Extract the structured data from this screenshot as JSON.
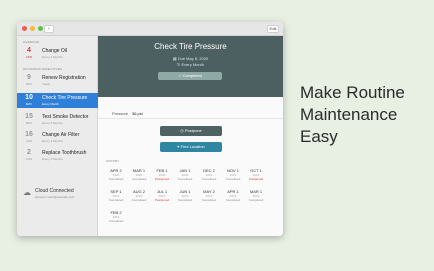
{
  "titlebar": {
    "back": "‹",
    "edit": "Edit"
  },
  "sidebar": {
    "overdue_header": "OVERDUE",
    "upcoming_header": "UPCOMING DIRECTIVES",
    "overdue": [
      {
        "num": "4",
        "mon": "APR",
        "name": "Change Oil",
        "sub": "Every 3 Months"
      }
    ],
    "upcoming": [
      {
        "num": "9",
        "mon": "MAY",
        "name": "Renew Registration",
        "sub": "Yearly"
      },
      {
        "num": "10",
        "mon": "MAY",
        "name": "Check Tire Pressure",
        "sub": "Every Month"
      },
      {
        "num": "15",
        "mon": "MAY",
        "name": "Test Smoke Detector",
        "sub": "Every 6 Months"
      },
      {
        "num": "16",
        "mon": "JUN",
        "name": "Change Air Filter",
        "sub": "Every 3 Months"
      },
      {
        "num": "2",
        "mon": "AUG",
        "name": "Replace Toothbrush",
        "sub": "Every 3 Months"
      }
    ],
    "cloud": {
      "title": "Cloud Connected",
      "sub": "Account: user@example.com"
    }
  },
  "detail": {
    "title": "Check Tire Pressure",
    "due": "Due May 8, 2020",
    "every": "Every Month",
    "completed": "Completed",
    "pressure_label": "Pressure",
    "pressure_value": "36 psi",
    "postpone": "Postpone",
    "find_location": "Find Location",
    "history_header": "HISTORY",
    "history": [
      {
        "d": "APR 2",
        "y": "2020",
        "s": "Completed",
        "late": false
      },
      {
        "d": "MAR 1",
        "y": "2020",
        "s": "Completed",
        "late": false
      },
      {
        "d": "FEB 1",
        "y": "2020",
        "s": "Postponed",
        "late": true
      },
      {
        "d": "JAN 1",
        "y": "2020",
        "s": "Completed",
        "late": false
      },
      {
        "d": "DEC 2",
        "y": "2019",
        "s": "Completed",
        "late": false
      },
      {
        "d": "NOV 1",
        "y": "2019",
        "s": "Completed",
        "late": false
      },
      {
        "d": "OCT 1",
        "y": "2019",
        "s": "Postponed",
        "late": true
      },
      {
        "d": "SEP 1",
        "y": "2019",
        "s": "Completed",
        "late": false
      },
      {
        "d": "AUG 2",
        "y": "2019",
        "s": "Completed",
        "late": false
      },
      {
        "d": "JUL 1",
        "y": "2019",
        "s": "Postponed",
        "late": true
      },
      {
        "d": "JUN 1",
        "y": "2019",
        "s": "Completed",
        "late": false
      },
      {
        "d": "MAY 2",
        "y": "2019",
        "s": "Completed",
        "late": false
      },
      {
        "d": "APR 1",
        "y": "2019",
        "s": "Completed",
        "late": false
      },
      {
        "d": "MAR 1",
        "y": "2019",
        "s": "Completed",
        "late": false
      },
      {
        "d": "FEB 2",
        "y": "2019",
        "s": "Completed",
        "late": false
      }
    ]
  },
  "tagline": [
    "Make Routine",
    "Maintenance",
    "Easy"
  ],
  "colors": {
    "header": "#4c6061",
    "selected": "#2f7fd8",
    "find": "#2e86a3",
    "overdue": "#d83a3a",
    "background": "#e8efe3"
  }
}
